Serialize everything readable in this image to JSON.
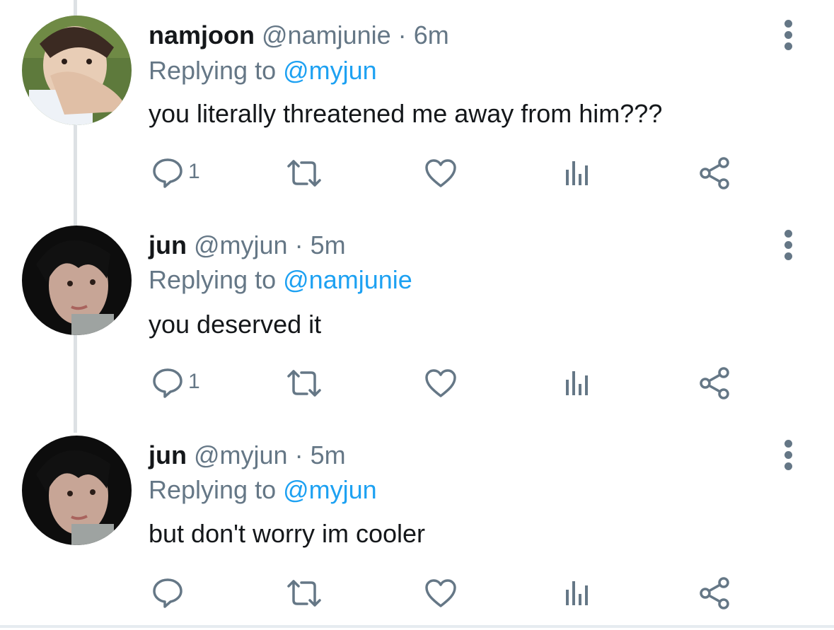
{
  "tweets": [
    {
      "name": "namjoon",
      "handle": "@namjunie",
      "sep": "·",
      "time": "6m",
      "replying_prefix": "Replying to",
      "replying_to": "@myjun",
      "text": "you literally threatened me away from him???",
      "reply_count": "1",
      "avatar": "namjoon-avatar"
    },
    {
      "name": "jun",
      "handle": "@myjun",
      "sep": "·",
      "time": "5m",
      "replying_prefix": "Replying to",
      "replying_to": "@namjunie",
      "text": "you deserved it",
      "reply_count": "1",
      "avatar": "jun-avatar"
    },
    {
      "name": "jun",
      "handle": "@myjun",
      "sep": "·",
      "time": "5m",
      "replying_prefix": "Replying to",
      "replying_to": "@myjun",
      "text": "but don't worry im cooler",
      "reply_count": "",
      "avatar": "jun-avatar"
    }
  ],
  "icons": {
    "reply": "reply-icon",
    "retweet": "retweet-icon",
    "like": "heart-icon",
    "analytics": "analytics-icon",
    "share": "share-icon",
    "more": "more-vertical-icon"
  },
  "colors": {
    "accent": "#1da1f2",
    "muted": "#657786",
    "text": "#14171a",
    "thread_line": "#dde1e4"
  }
}
